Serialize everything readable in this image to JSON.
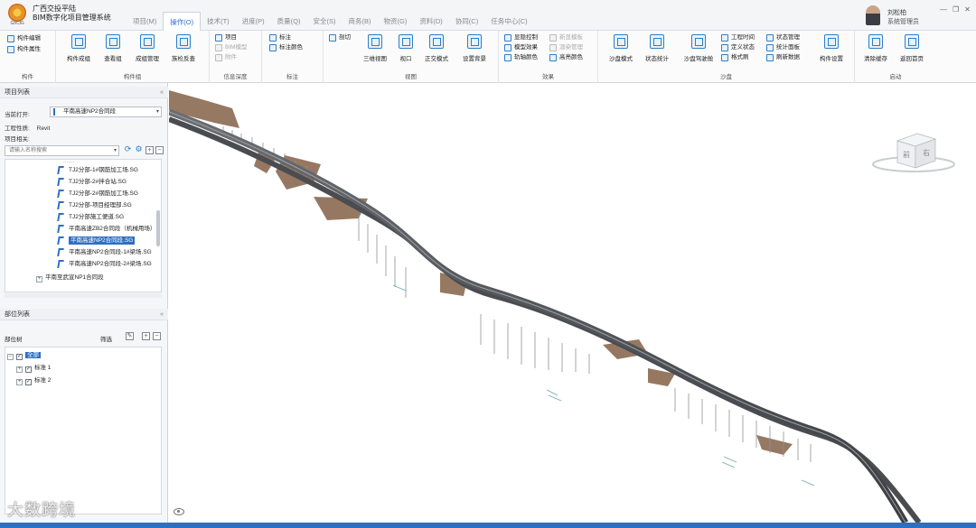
{
  "app": {
    "logo_text": "GXCIG",
    "company": "广西交投平陆",
    "system": "BIM数字化项目管理系统"
  },
  "menu": [
    {
      "label": "项目(M)",
      "active": false
    },
    {
      "label": "操作(O)",
      "active": true
    },
    {
      "label": "技术(T)",
      "active": false
    },
    {
      "label": "进度(P)",
      "active": false
    },
    {
      "label": "质量(Q)",
      "active": false
    },
    {
      "label": "安全(S)",
      "active": false
    },
    {
      "label": "商务(B)",
      "active": false
    },
    {
      "label": "物资(G)",
      "active": false
    },
    {
      "label": "资料(D)",
      "active": false
    },
    {
      "label": "协同(C)",
      "active": false
    },
    {
      "label": "任务中心(C)",
      "active": false
    }
  ],
  "user": {
    "name": "刘松柏",
    "role": "系统管理员"
  },
  "window_controls": [
    "—",
    "❐",
    "✕"
  ],
  "ribbon": {
    "groups": {
      "component": "构件",
      "component_group": "构件组",
      "info_depth": "信息深度",
      "annotate": "标注",
      "view": "视图",
      "effect": "效果",
      "sandbox": "沙盘",
      "start": "启动"
    },
    "component": {
      "edit": "构件编辑",
      "props": "构件属性"
    },
    "component_group": {
      "create": "构件成组",
      "view": "查看组",
      "manage": "成组管理",
      "check": "族检反查"
    },
    "info_depth": {
      "project": "项目",
      "bim_model": "BIM模型",
      "attached": "附件"
    },
    "annotate": {
      "mark": "标注",
      "mark_color": "标注颜色"
    },
    "view": {
      "section": "剖切",
      "three_view": "三维视图",
      "window": "视口",
      "ortho": "正交模式",
      "set_bg": "设置背景"
    },
    "effect": {
      "hide_ctrl": "显隐控制",
      "model_effect": "模型效果",
      "axis_color": "轨轴颜色",
      "new_model": "新显模板",
      "render_mgr": "渲染管理",
      "highlight": "高亮颜色"
    },
    "sandbox": {
      "sand_mode": "沙盘模式",
      "status_stat": "状态统计",
      "sand_drive": "沙盘驾驶舱",
      "proj_time": "工程时间",
      "def_status": "定义状态",
      "style_brush": "格式刷",
      "status_mgr": "状态管理",
      "stat_panel": "统计面板",
      "refresh": "刷新数据",
      "comp_setting": "构件设置"
    },
    "start": {
      "clear_cache": "清除缓存",
      "back_home": "返回首页"
    }
  },
  "project_panel": {
    "title": "项目列表",
    "current_label": "当前打开:",
    "current_value": "平南高速NP2合同段",
    "eng_type_label": "工程性质:",
    "eng_type_value": "Revit",
    "related_label": "项目相关:",
    "search_placeholder": "请输入名称搜索",
    "tree": [
      {
        "label": "TJ2分部-1#钢筋加工场.SG",
        "indent": 1,
        "selected": false
      },
      {
        "label": "TJ2分部-2#拌合站.SG",
        "indent": 1,
        "selected": false
      },
      {
        "label": "TJ2分部-2#钢筋加工场.SG",
        "indent": 1,
        "selected": false
      },
      {
        "label": "TJ2分部-项目经理部.SG",
        "indent": 1,
        "selected": false
      },
      {
        "label": "TJ2分部施工便道.SG",
        "indent": 1,
        "selected": false
      },
      {
        "label": "平南高速ZB2合同段（机械用场）",
        "indent": 1,
        "selected": false
      },
      {
        "label": "平南高速NP2合同段.SG",
        "indent": 1,
        "selected": true
      },
      {
        "label": "平南高速NP2合同段-1#梁场.SG",
        "indent": 1,
        "selected": false
      },
      {
        "label": "平南高速NP2合同段-2#梁场.SG",
        "indent": 1,
        "selected": false
      },
      {
        "label": "平南至武宣NP1合同段",
        "indent": 0,
        "selected": false
      }
    ]
  },
  "parts_panel": {
    "title": "部位列表",
    "list_label": "部位树",
    "filter_label": "筛选",
    "nodes": [
      {
        "label": "全部",
        "level": 0,
        "selected": true
      },
      {
        "label": "标准 1",
        "level": 1,
        "selected": false
      },
      {
        "label": "标准 2",
        "level": 1,
        "selected": false
      }
    ]
  },
  "viewcube": {
    "front": "前",
    "right": "右"
  },
  "watermark": "大数跨境"
}
